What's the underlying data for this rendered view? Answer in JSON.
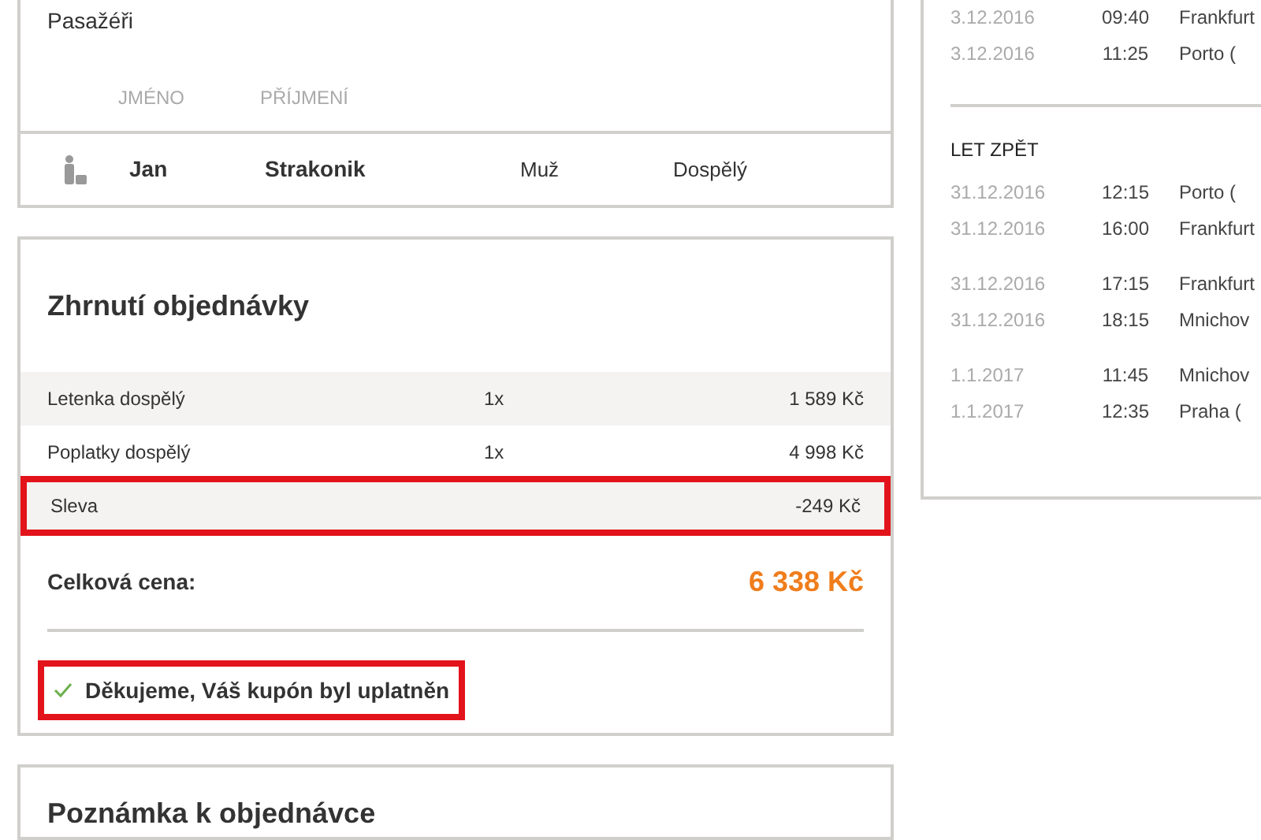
{
  "passengers": {
    "title": "Pasažéři",
    "columns": [
      "JMÉNO",
      "PŘÍJMENÍ"
    ],
    "rows": [
      {
        "first_name": "Jan",
        "last_name": "Strakonik",
        "gender": "Muž",
        "type": "Dospělý"
      }
    ]
  },
  "summary": {
    "title": "Zhrnutí objednávky",
    "rows": [
      {
        "label": "Letenka dospělý",
        "qty": "1x",
        "price": "1 589 Kč",
        "highlighted": false
      },
      {
        "label": "Poplatky dospělý",
        "qty": "1x",
        "price": "4 998 Kč",
        "highlighted": false
      },
      {
        "label": "Sleva",
        "price": "-249 Kč",
        "highlighted": true
      }
    ],
    "total_label": "Celková cena:",
    "total": "6 338 Kč",
    "coupon_message": {
      "text": "Děkujeme, Váš kupón byl uplatněn",
      "highlighted": true
    }
  },
  "note": {
    "title": "Poznámka k objednávce"
  },
  "flights": {
    "outbound": [
      [
        {
          "date": "3.12.2016",
          "time": "09:40",
          "place": "Frankfurt"
        },
        {
          "date": "3.12.2016",
          "time": "11:25",
          "place": "Porto ("
        }
      ]
    ],
    "return_title": "LET ZPĚT",
    "return": [
      [
        {
          "date": "31.12.2016",
          "time": "12:15",
          "place": "Porto ("
        },
        {
          "date": "31.12.2016",
          "time": "16:00",
          "place": "Frankfurt"
        }
      ],
      [
        {
          "date": "31.12.2016",
          "time": "17:15",
          "place": "Frankfurt"
        },
        {
          "date": "31.12.2016",
          "time": "18:15",
          "place": "Mnichov"
        }
      ],
      [
        {
          "date": "1.1.2017",
          "time": "11:45",
          "place": "Mnichov"
        },
        {
          "date": "1.1.2017",
          "time": "12:35",
          "place": "Praha ("
        }
      ]
    ]
  }
}
